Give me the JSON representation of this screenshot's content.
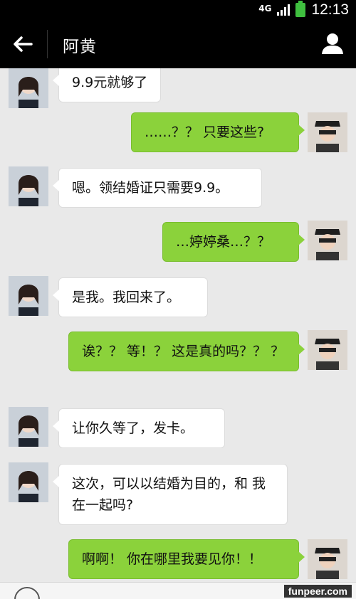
{
  "status": {
    "network": "4G",
    "time": "12:13",
    "battery_color": "#3fbf3f"
  },
  "header": {
    "title": "阿黄",
    "back_icon": "arrow-left-icon",
    "profile_icon": "person-icon"
  },
  "messages": [
    {
      "side": "in",
      "text": "9.9元就够了"
    },
    {
      "side": "out",
      "text": "……？？ 只要这些?"
    },
    {
      "side": "in",
      "text": "嗯。领结婚证只需要9.9。"
    },
    {
      "side": "out",
      "text": "…婷婷桑…？？"
    },
    {
      "side": "in",
      "text": "是我。我回来了。"
    },
    {
      "side": "out",
      "text": "诶？？ 等！？ 这是真的吗？？ ？"
    },
    {
      "side": "in",
      "text": "让你久等了，发卡。"
    },
    {
      "side": "in",
      "text": "这次，可以以结婚为目的，和 我在一起吗?"
    },
    {
      "side": "out",
      "text": "啊啊！ 你在哪里我要见你！！"
    }
  ],
  "watermark": "funpeer.com",
  "colors": {
    "outgoing_bubble": "#8bd23b",
    "incoming_bubble": "#ffffff",
    "header_bg": "#000000",
    "chat_bg": "#e9e9e9"
  }
}
